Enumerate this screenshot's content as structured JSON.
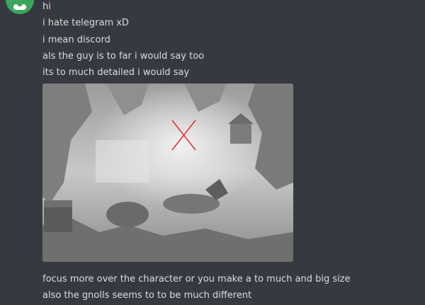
{
  "messages": [
    "hi",
    "i hate telegram xD",
    "i mean discord",
    "als the guy is to far i would say too",
    "its to much detailed i would say",
    "focus more over the character or you make a to much and big size",
    "also the gnolls seems to to be much different"
  ],
  "attachment": {
    "icon": "pencil-drawing-image",
    "annotation_icon": "red-x-mark",
    "annotation_color": "#e0323a"
  },
  "colors": {
    "background": "#36393f",
    "text": "#dcddde",
    "avatar": "#3ba55d"
  }
}
